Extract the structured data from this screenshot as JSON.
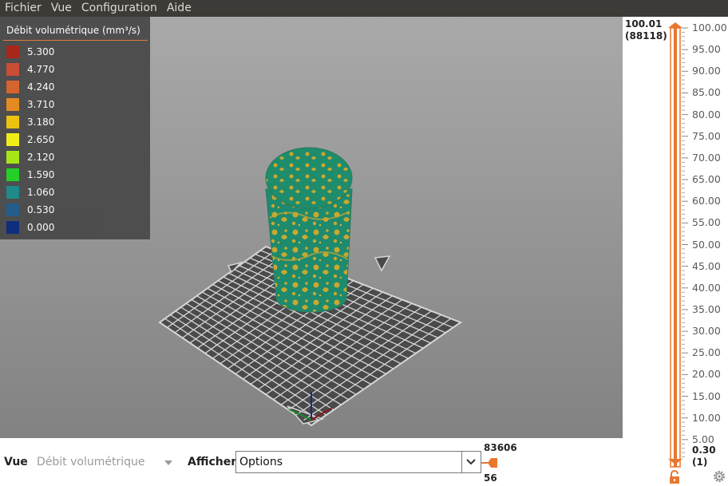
{
  "menu": {
    "items": [
      "Fichier",
      "Vue",
      "Configuration",
      "Aide"
    ]
  },
  "legend": {
    "title": "Débit volumétrique (mm³/s)",
    "entries": [
      {
        "value": "5.300",
        "color": "#a82216"
      },
      {
        "value": "4.770",
        "color": "#cc4a32"
      },
      {
        "value": "4.240",
        "color": "#d9622a"
      },
      {
        "value": "3.710",
        "color": "#e88a1e"
      },
      {
        "value": "3.180",
        "color": "#f0c40a"
      },
      {
        "value": "2.650",
        "color": "#f5f212"
      },
      {
        "value": "2.120",
        "color": "#a8e812"
      },
      {
        "value": "1.590",
        "color": "#20d224"
      },
      {
        "value": "1.060",
        "color": "#1a8a8a"
      },
      {
        "value": "0.530",
        "color": "#205a8a"
      },
      {
        "value": "0.000",
        "color": "#0a2a80"
      }
    ]
  },
  "layer_slider": {
    "top_value": "100.01",
    "top_index": "(88118)",
    "bottom_value": "0.30",
    "bottom_index": "(1)",
    "ticks": [
      "100.00",
      "95.00",
      "90.00",
      "85.00",
      "80.00",
      "75.00",
      "70.00",
      "65.00",
      "60.00",
      "55.00",
      "50.00",
      "45.00",
      "40.00",
      "35.00",
      "30.00",
      "25.00",
      "20.00",
      "15.00",
      "10.00",
      "5.00"
    ],
    "accent_color": "#e8772e",
    "icons": [
      "lock-icon",
      "gear-icon"
    ]
  },
  "bottom_bar": {
    "view_label": "Vue",
    "view_value": "Débit volumétrique",
    "show_label": "Afficher",
    "options_value": "Options"
  },
  "horizontal_slider": {
    "top_value": "83606",
    "bottom_value": "56"
  },
  "colors": {
    "viewport_top": "#a9a9a9",
    "viewport_bottom": "#828282",
    "bed": "#4a4a4a",
    "model_base": "#1e8a6e",
    "model_pattern": "#c9a830",
    "accent": "#e8772e"
  }
}
